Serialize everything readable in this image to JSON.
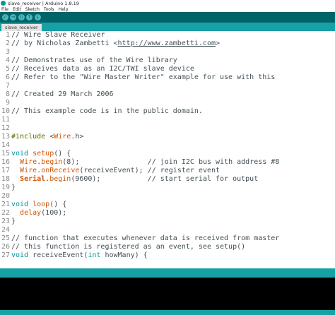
{
  "window": {
    "title": "slave_receiver | Arduino 1.8.19"
  },
  "menu": [
    "File",
    "Edit",
    "Sketch",
    "Tools",
    "Help"
  ],
  "tab": {
    "label": "slave_receiver"
  },
  "lines": [
    [
      {
        "t": "// Wire Slave Receiver"
      }
    ],
    [
      {
        "t": "// by Nicholas Zambetti <"
      },
      {
        "t": "http://www.zambetti.com",
        "c": "link"
      },
      {
        "t": ">"
      }
    ],
    [
      {
        "t": ""
      }
    ],
    [
      {
        "t": "// Demonstrates use of the Wire library"
      }
    ],
    [
      {
        "t": "// Receives data as an I2C/TWI slave device"
      }
    ],
    [
      {
        "t": "// Refer to the \"Wire Master Writer\" example for use with this"
      }
    ],
    [
      {
        "t": ""
      }
    ],
    [
      {
        "t": "// Created 29 March 2006"
      }
    ],
    [
      {
        "t": ""
      }
    ],
    [
      {
        "t": "// This example code is in the public domain."
      }
    ],
    [
      {
        "t": ""
      }
    ],
    [
      {
        "t": ""
      }
    ],
    [
      {
        "t": "#include ",
        "c": "kw-pp"
      },
      {
        "t": "<"
      },
      {
        "t": "Wire",
        "c": "kw-fn"
      },
      {
        "t": ".h>"
      }
    ],
    [
      {
        "t": ""
      }
    ],
    [
      {
        "t": "void",
        "c": "kw-type"
      },
      {
        "t": " "
      },
      {
        "t": "setup",
        "c": "kw-fn"
      },
      {
        "t": "() {"
      }
    ],
    [
      {
        "t": "  "
      },
      {
        "t": "Wire",
        "c": "kw-fn"
      },
      {
        "t": "."
      },
      {
        "t": "begin",
        "c": "kw-fn"
      },
      {
        "t": "(8);                // join I2C bus with address #8"
      }
    ],
    [
      {
        "t": "  "
      },
      {
        "t": "Wire",
        "c": "kw-fn"
      },
      {
        "t": "."
      },
      {
        "t": "onReceive",
        "c": "kw-fn"
      },
      {
        "t": "(receiveEvent); // register event"
      }
    ],
    [
      {
        "t": "  "
      },
      {
        "t": "Serial",
        "c": "kw-cls"
      },
      {
        "t": "."
      },
      {
        "t": "begin",
        "c": "kw-fn"
      },
      {
        "t": "(9600);           // start serial for output"
      }
    ],
    [
      {
        "t": "}"
      }
    ],
    [
      {
        "t": ""
      }
    ],
    [
      {
        "t": "void",
        "c": "kw-type"
      },
      {
        "t": " "
      },
      {
        "t": "loop",
        "c": "kw-fn"
      },
      {
        "t": "() {"
      }
    ],
    [
      {
        "t": "  "
      },
      {
        "t": "delay",
        "c": "kw-fn"
      },
      {
        "t": "(100);"
      }
    ],
    [
      {
        "t": "}"
      }
    ],
    [
      {
        "t": ""
      }
    ],
    [
      {
        "t": "// function that executes whenever data is received from master"
      }
    ],
    [
      {
        "t": "// this function is registered as an event, see setup()"
      }
    ],
    [
      {
        "t": "void",
        "c": "kw-type"
      },
      {
        "t": " receiveEvent("
      },
      {
        "t": "int",
        "c": "kw-type"
      },
      {
        "t": " howMany) {"
      }
    ]
  ]
}
